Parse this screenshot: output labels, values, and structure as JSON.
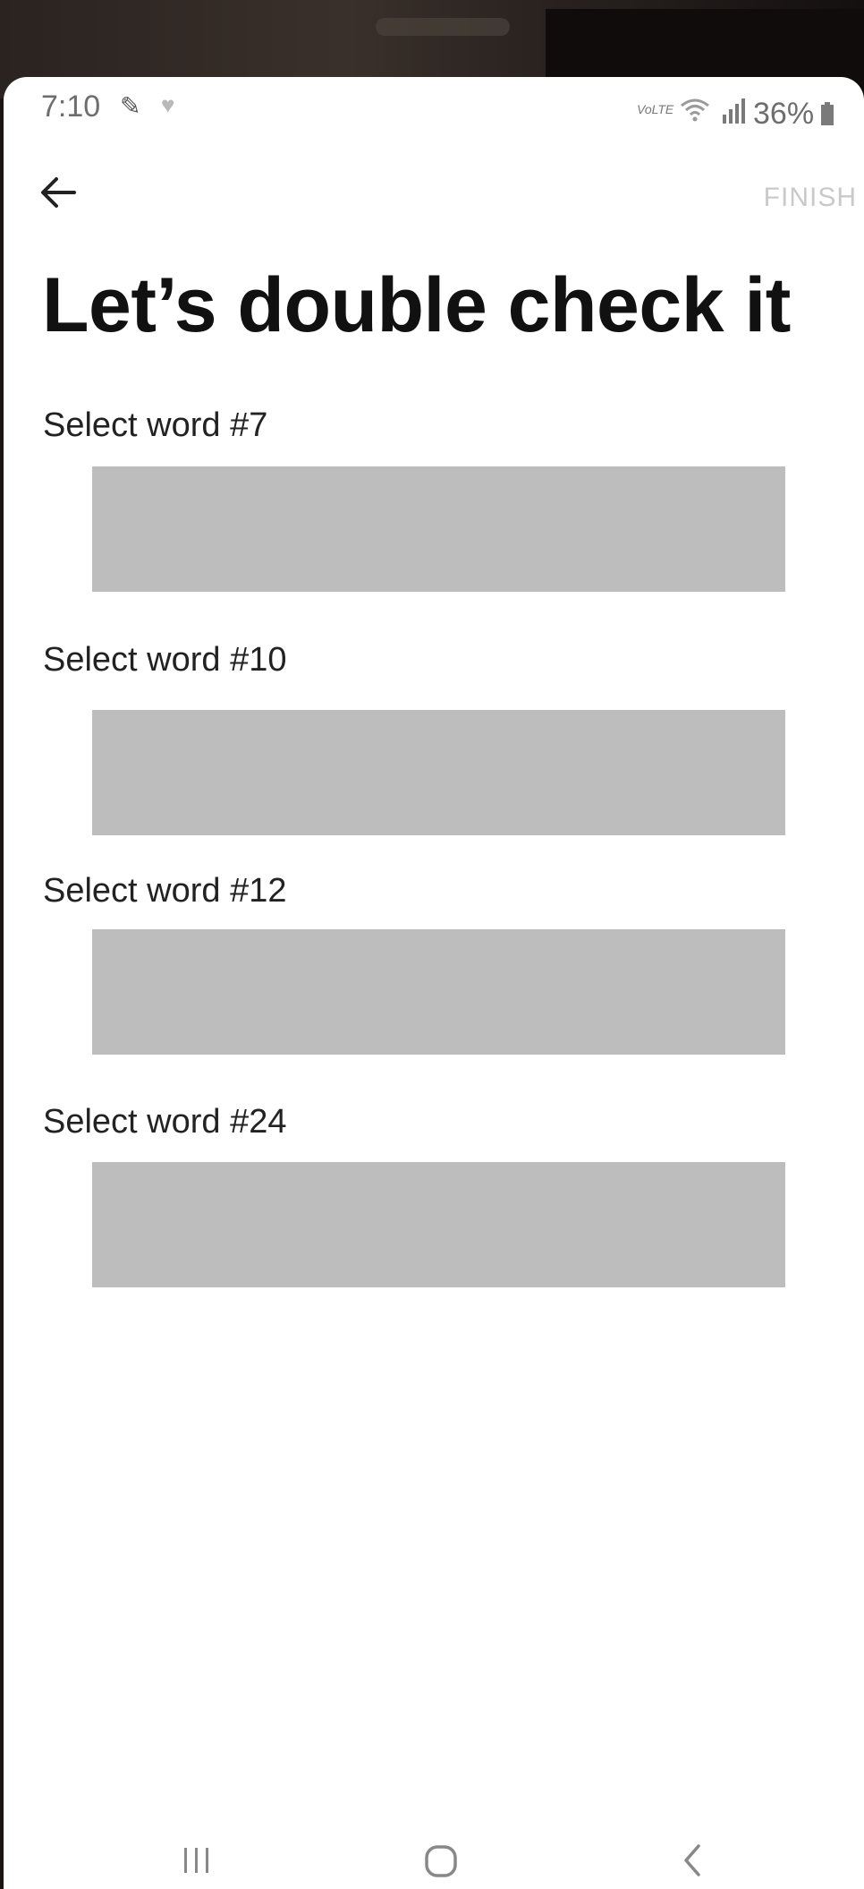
{
  "status_bar": {
    "time": "7:10",
    "lte": "VoLTE",
    "battery": "36%"
  },
  "header": {
    "finish_label": "FINISH"
  },
  "title": "Let’s double check it",
  "word_selections": [
    {
      "label": "Select word #7"
    },
    {
      "label": "Select word #10"
    },
    {
      "label": "Select word #12"
    },
    {
      "label": "Select word #24"
    }
  ],
  "icons": {
    "back": "arrow-left-icon",
    "nav_recents": "recents-icon",
    "nav_home": "home-icon",
    "nav_back": "chevron-left-icon"
  },
  "colors": {
    "word_box": "#bdbdbd",
    "finish_disabled": "#c9c9c9",
    "title": "#111111"
  }
}
